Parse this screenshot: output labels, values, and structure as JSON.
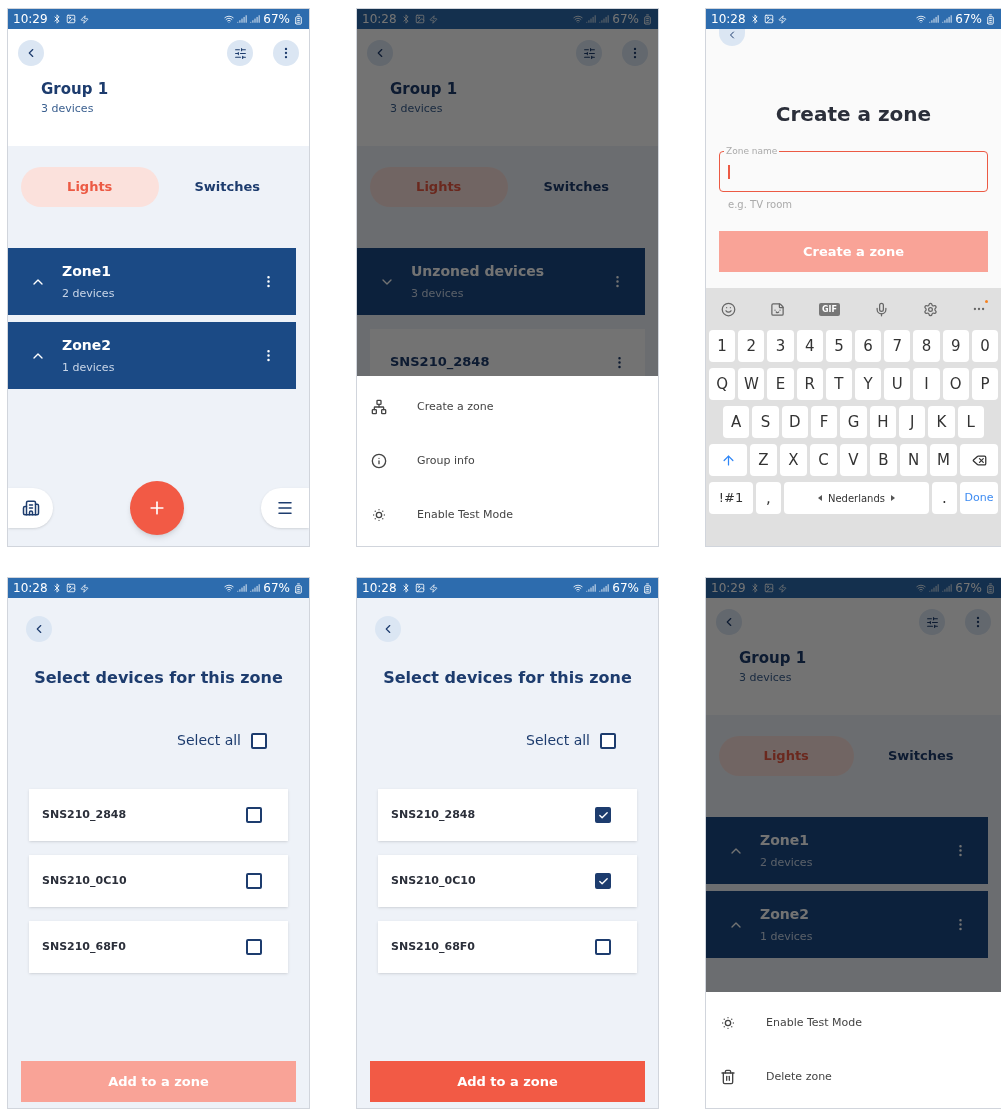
{
  "screens": [
    {
      "kind": "group",
      "status": {
        "time": "10:29",
        "battery": "67%"
      },
      "title": "Group 1",
      "subtitle": "3 devices",
      "tabs": [
        {
          "label": "Lights",
          "selected": true
        },
        {
          "label": "Switches",
          "selected": false
        }
      ],
      "items": [
        {
          "kind": "zone",
          "name": "Zone1",
          "count": "2 devices",
          "expanded": true
        },
        {
          "kind": "zone",
          "name": "Zone2",
          "count": "1 devices",
          "expanded": true
        }
      ]
    },
    {
      "kind": "group",
      "status": {
        "time": "10:28",
        "battery": "67%"
      },
      "title": "Group 1",
      "subtitle": "3 devices",
      "tabs": [
        {
          "label": "Lights",
          "selected": true
        },
        {
          "label": "Switches",
          "selected": false
        }
      ],
      "items": [
        {
          "kind": "zone",
          "name": "Unzoned devices",
          "count": "3 devices",
          "expanded": false
        },
        {
          "kind": "device",
          "name": "SNS210_2848"
        }
      ],
      "sheet": [
        {
          "kind": "zone",
          "label": "Create a zone"
        },
        {
          "kind": "info",
          "label": "Group info"
        },
        {
          "kind": "test",
          "label": "Enable Test Mode"
        }
      ]
    },
    {
      "kind": "create",
      "status": {
        "time": "10:28",
        "battery": "67%"
      },
      "title": "Create a zone",
      "field": {
        "label": "Zone name",
        "helper": "e.g. TV room"
      },
      "button": {
        "label": "Create a zone",
        "disabled": true
      },
      "keyboard": {
        "gif": "GIF",
        "rows": [
          [
            "1",
            "2",
            "3",
            "4",
            "5",
            "6",
            "7",
            "8",
            "9",
            "0"
          ],
          [
            "Q",
            "W",
            "E",
            "R",
            "T",
            "Y",
            "U",
            "I",
            "O",
            "P"
          ],
          [
            "A",
            "S",
            "D",
            "F",
            "G",
            "H",
            "J",
            "K",
            "L"
          ],
          [
            "Z",
            "X",
            "C",
            "V",
            "B",
            "N",
            "M"
          ]
        ],
        "symbols": "!#1",
        "comma": ",",
        "space": "Nederlands",
        "period": ".",
        "done": "Done"
      }
    },
    {
      "kind": "select",
      "status": {
        "time": "10:28",
        "battery": "67%"
      },
      "title": "Select devices for this zone",
      "select_all": {
        "label": "Select all",
        "checked": false
      },
      "devices": [
        {
          "name": "SNS210_2848",
          "checked": false
        },
        {
          "name": "SNS210_0C10",
          "checked": false
        },
        {
          "name": "SNS210_68F0",
          "checked": false
        }
      ],
      "button": {
        "label": "Add to a zone",
        "disabled": true
      }
    },
    {
      "kind": "select",
      "status": {
        "time": "10:28",
        "battery": "67%"
      },
      "title": "Select devices for this zone",
      "select_all": {
        "label": "Select all",
        "checked": false
      },
      "devices": [
        {
          "name": "SNS210_2848",
          "checked": true
        },
        {
          "name": "SNS210_0C10",
          "checked": true
        },
        {
          "name": "SNS210_68F0",
          "checked": false
        }
      ],
      "button": {
        "label": "Add to a zone",
        "disabled": false
      }
    },
    {
      "kind": "group",
      "status": {
        "time": "10:29",
        "battery": "67%"
      },
      "title": "Group 1",
      "subtitle": "3 devices",
      "tabs": [
        {
          "label": "Lights",
          "selected": true
        },
        {
          "label": "Switches",
          "selected": false
        }
      ],
      "items": [
        {
          "kind": "zone",
          "name": "Zone1",
          "count": "2 devices",
          "expanded": true
        },
        {
          "kind": "zone",
          "name": "Zone2",
          "count": "1 devices",
          "expanded": true
        }
      ],
      "sheet": [
        {
          "kind": "test",
          "label": "Enable Test Mode"
        },
        {
          "kind": "delete",
          "label": "Delete zone"
        }
      ]
    }
  ]
}
